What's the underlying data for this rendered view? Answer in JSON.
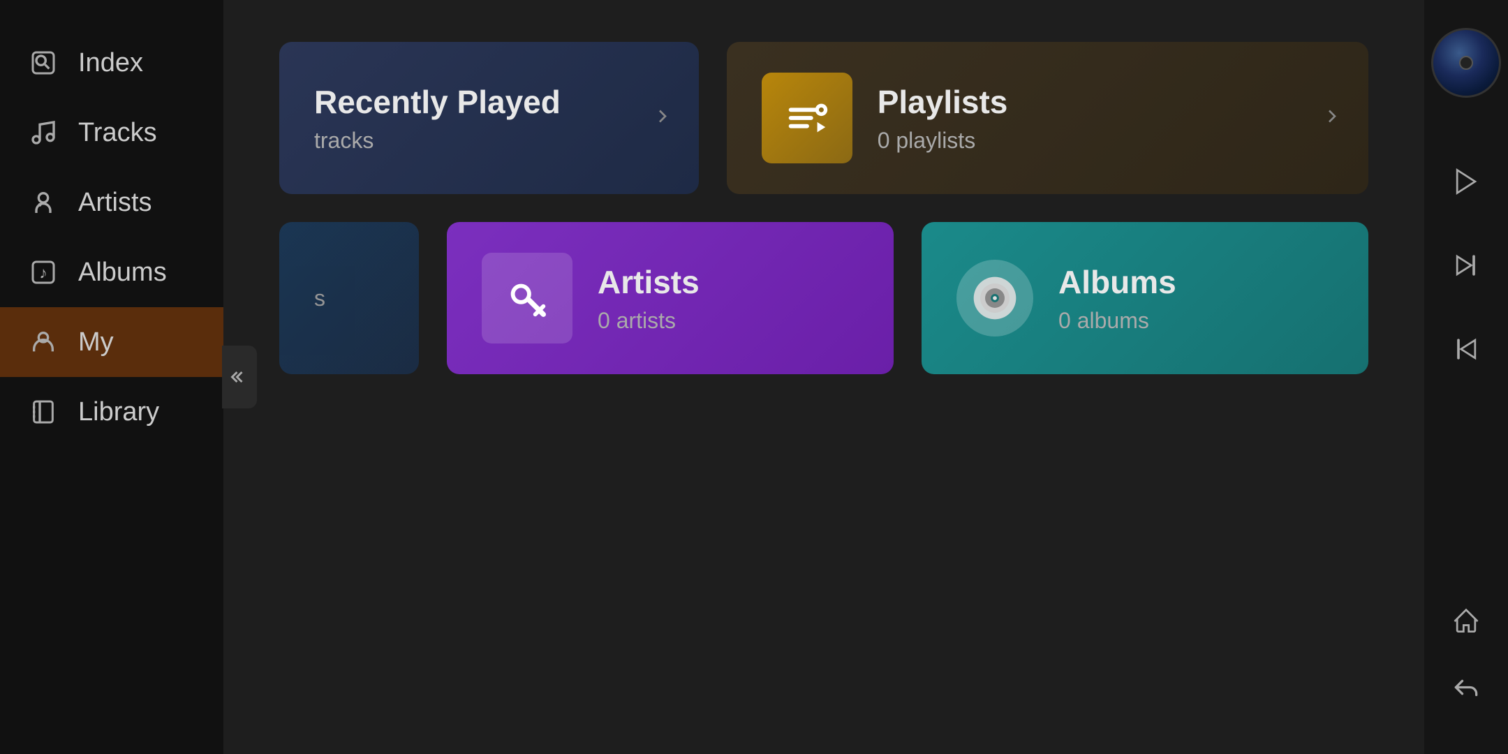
{
  "sidebar": {
    "items": [
      {
        "id": "index",
        "label": "Index",
        "icon": "search-icon",
        "active": false
      },
      {
        "id": "tracks",
        "label": "Tracks",
        "icon": "music-note-icon",
        "active": false
      },
      {
        "id": "artists",
        "label": "Artists",
        "icon": "microphone-icon",
        "active": false
      },
      {
        "id": "albums",
        "label": "Albums",
        "icon": "album-icon",
        "active": false
      },
      {
        "id": "my",
        "label": "My",
        "icon": "person-icon",
        "active": true
      },
      {
        "id": "library",
        "label": "Library",
        "icon": "library-icon",
        "active": false
      }
    ]
  },
  "main": {
    "row1": {
      "recently_played": {
        "title": "Recently Played",
        "subtitle": "tracks"
      },
      "playlists": {
        "title": "Playlists",
        "subtitle": "0 playlists"
      }
    },
    "row2": {
      "tracks": {
        "subtitle": "s"
      },
      "artists": {
        "title": "Artists",
        "subtitle": "0 artists"
      },
      "albums": {
        "title": "Albums",
        "subtitle": "0 albums"
      }
    }
  },
  "controls": {
    "play_label": "play",
    "next_label": "next",
    "prev_label": "previous",
    "home_label": "home",
    "back_label": "back"
  },
  "collapse": {
    "label": "collapse"
  }
}
